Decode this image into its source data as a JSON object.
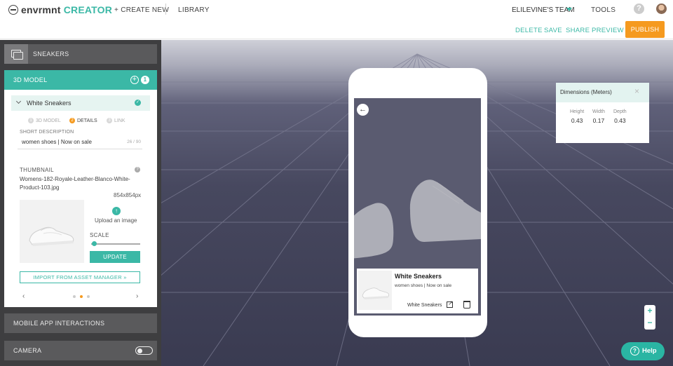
{
  "topbar": {
    "logo_main": "envrmnt",
    "logo_accent": "CREATOR",
    "create_new": "+ CREATE NEW",
    "library": "LIBRARY",
    "team": "ELILEVINE'S TEAM",
    "tools": "TOOLS",
    "help_icon": "?"
  },
  "actions": {
    "delete": "DELETE",
    "save": "SAVE",
    "share": "SHARE",
    "preview": "PREVIEW",
    "publish": "PUBLISH"
  },
  "left_panel": {
    "project": "SNEAKERS",
    "section": "3D MODEL",
    "add_icon": "+",
    "model_count": "1",
    "item_title": "White Sneakers",
    "steps": [
      {
        "num": "1",
        "label": "3D MODEL"
      },
      {
        "num": "2",
        "label": "DETAILS"
      },
      {
        "num": "3",
        "label": "LINK"
      }
    ],
    "short_desc_label": "SHORT DESCRIPTION",
    "short_desc_value": "women shoes | Now on sale",
    "short_desc_count": "26 / 90",
    "thumbnail_label": "THUMBNAIL",
    "thumbnail_help": "?",
    "thumbnail_filename": "Womens-182-Royale-Leather-Blanco-White-Product-103.jpg",
    "thumbnail_dims": "854x854px",
    "upload_label": "Upload an image",
    "scale_label": "SCALE",
    "scale_value": 0.05,
    "update_label": "UPDATE",
    "import_label": "IMPORT FROM ASSET MANAGER »",
    "pager_prev": "‹",
    "pager_next": "›",
    "mobile_interactions": "MOBILE APP INTERACTIONS",
    "camera": "CAMERA"
  },
  "phone": {
    "back_icon": "←",
    "card_title": "White Sneakers",
    "card_subtitle": "women shoes | Now on sale",
    "card_link": "White Sneakers"
  },
  "dimensions": {
    "title": "Dimensions (Meters)",
    "close": "×",
    "height_label": "Height",
    "width_label": "Width",
    "depth_label": "Depth",
    "height": "0.43",
    "width": "0.17",
    "depth": "0.43"
  },
  "zoom": {
    "in": "+",
    "out": "−"
  },
  "help": {
    "label": "Help",
    "icon": "?"
  },
  "colors": {
    "accent": "#3bb8a6",
    "publish": "#f59a1f",
    "panel_dark": "#3e3e40"
  }
}
